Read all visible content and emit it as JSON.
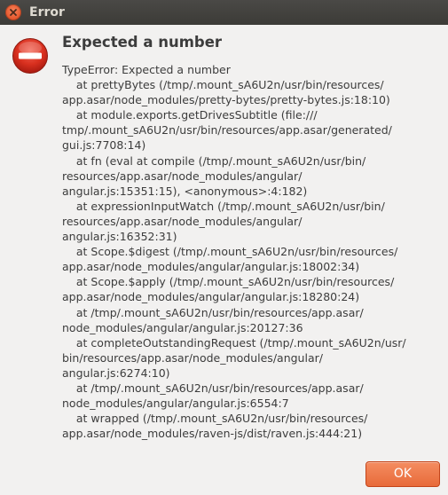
{
  "window": {
    "title": "Error",
    "accent_color": "#e95420"
  },
  "dialog": {
    "icon": "error-icon",
    "heading": "Expected a number",
    "message_lines": [
      "TypeError: Expected a number",
      "    at prettyBytes (/tmp/.mount_sA6U2n/usr/bin/resources/",
      "app.asar/node_modules/pretty-bytes/pretty-bytes.js:18:10)",
      "    at module.exports.getDrivesSubtitle (file:///",
      "tmp/.mount_sA6U2n/usr/bin/resources/app.asar/generated/",
      "gui.js:7708:14)",
      "    at fn (eval at compile (/tmp/.mount_sA6U2n/usr/bin/",
      "resources/app.asar/node_modules/angular/",
      "angular.js:15351:15), <anonymous>:4:182)",
      "    at expressionInputWatch (/tmp/.mount_sA6U2n/usr/bin/",
      "resources/app.asar/node_modules/angular/",
      "angular.js:16352:31)",
      "    at Scope.$digest (/tmp/.mount_sA6U2n/usr/bin/resources/",
      "app.asar/node_modules/angular/angular.js:18002:34)",
      "    at Scope.$apply (/tmp/.mount_sA6U2n/usr/bin/resources/",
      "app.asar/node_modules/angular/angular.js:18280:24)",
      "    at /tmp/.mount_sA6U2n/usr/bin/resources/app.asar/",
      "node_modules/angular/angular.js:20127:36",
      "    at completeOutstandingRequest (/tmp/.mount_sA6U2n/usr/",
      "bin/resources/app.asar/node_modules/angular/",
      "angular.js:6274:10)",
      "    at /tmp/.mount_sA6U2n/usr/bin/resources/app.asar/",
      "node_modules/angular/angular.js:6554:7",
      "    at wrapped (/tmp/.mount_sA6U2n/usr/bin/resources/",
      "app.asar/node_modules/raven-js/dist/raven.js:444:21)"
    ]
  },
  "buttons": {
    "ok_label": "OK"
  }
}
